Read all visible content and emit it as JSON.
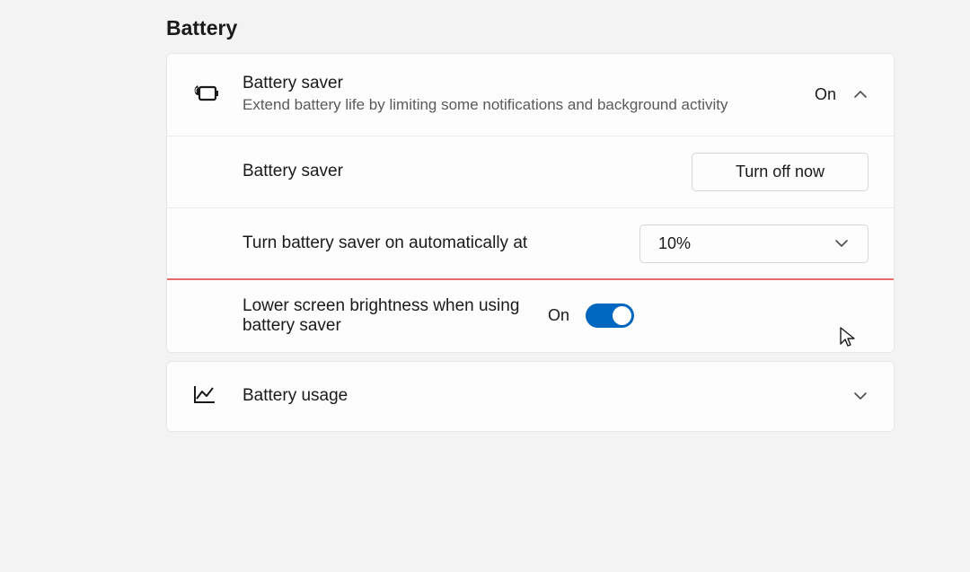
{
  "section": {
    "title": "Battery"
  },
  "batterySaver": {
    "header": {
      "title": "Battery saver",
      "description": "Extend battery life by limiting some notifications and background activity",
      "status": "On"
    },
    "toggleRow": {
      "label": "Battery saver",
      "buttonLabel": "Turn off now"
    },
    "autoRow": {
      "label": "Turn battery saver on automatically at",
      "selectedValue": "10%"
    },
    "brightnessRow": {
      "label": "Lower screen brightness when using battery saver",
      "status": "On"
    }
  },
  "batteryUsage": {
    "label": "Battery usage"
  }
}
